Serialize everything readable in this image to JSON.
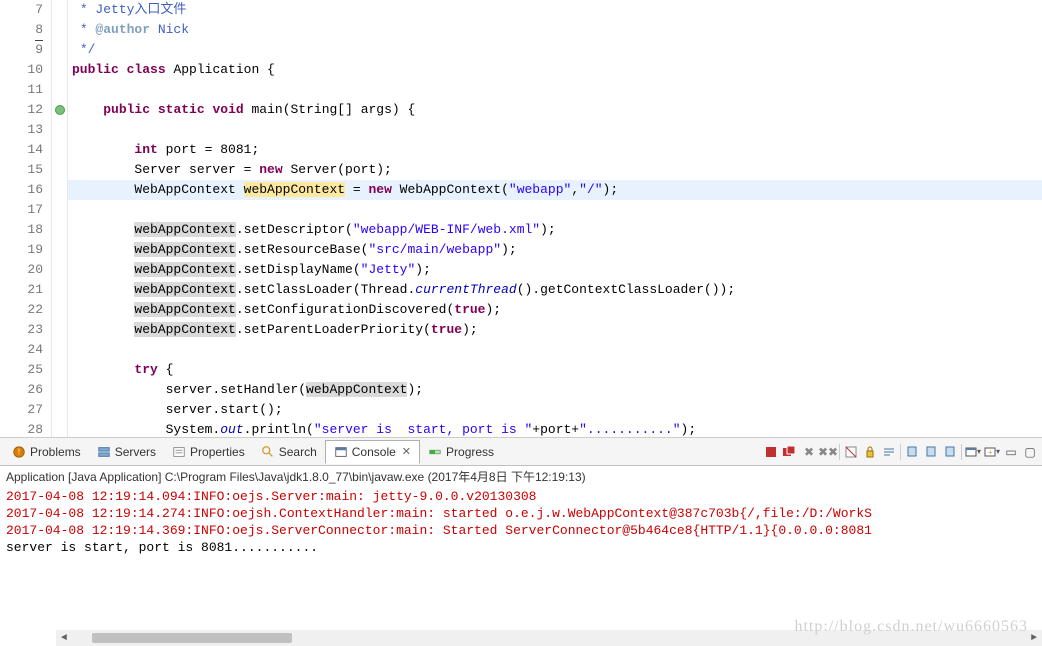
{
  "lines": [
    {
      "n": "7",
      "cls": "",
      "html": " <span class='com'>* Jetty入口文件</span>"
    },
    {
      "n": "8",
      "cls": "",
      "html": " <span class='com'>* <span class='com-tag'>@author</span> Nick</span>",
      "underline": true
    },
    {
      "n": "9",
      "cls": "",
      "html": " <span class='com'>*/</span>"
    },
    {
      "n": "10",
      "cls": "",
      "html": "<span class='kw'>public</span> <span class='kw'>class</span> Application {"
    },
    {
      "n": "11",
      "cls": "",
      "html": ""
    },
    {
      "n": "12",
      "cls": "",
      "html": "    <span class='kw'>public</span> <span class='kw'>static</span> <span class='kw'>void</span> main(String[] args) {",
      "marker": "green"
    },
    {
      "n": "13",
      "cls": "",
      "html": ""
    },
    {
      "n": "14",
      "cls": "",
      "html": "        <span class='kw'>int</span> port = 8081;"
    },
    {
      "n": "15",
      "cls": "",
      "html": "        Server server = <span class='kw'>new</span> Server(port);"
    },
    {
      "n": "16",
      "cls": "hl",
      "html": "        WebAppContext <span class='id-hl'>webAppContext</span> = <span class='kw'>new</span> WebAppContext(<span class='str'>\"webapp\"</span>,<span class='str'>\"/\"</span>);"
    },
    {
      "n": "17",
      "cls": "",
      "html": ""
    },
    {
      "n": "18",
      "cls": "",
      "html": "        <span class='id-ref'>webAppContext</span>.setDescriptor(<span class='str'>\"webapp/WEB-INF/web.xml\"</span>);"
    },
    {
      "n": "19",
      "cls": "",
      "html": "        <span class='id-ref'>webAppContext</span>.setResourceBase(<span class='str'>\"src/main/webapp\"</span>);"
    },
    {
      "n": "20",
      "cls": "",
      "html": "        <span class='id-ref'>webAppContext</span>.setDisplayName(<span class='str'>\"Jetty\"</span>);"
    },
    {
      "n": "21",
      "cls": "",
      "html": "        <span class='id-ref'>webAppContext</span>.setClassLoader(Thread.<span class='fld'>currentThread</span>().getContextClassLoader());"
    },
    {
      "n": "22",
      "cls": "",
      "html": "        <span class='id-ref'>webAppContext</span>.setConfigurationDiscovered(<span class='kw'>true</span>);"
    },
    {
      "n": "23",
      "cls": "",
      "html": "        <span class='id-ref'>webAppContext</span>.setParentLoaderPriority(<span class='kw'>true</span>);"
    },
    {
      "n": "24",
      "cls": "",
      "html": ""
    },
    {
      "n": "25",
      "cls": "",
      "html": "        <span class='kw'>try</span> {"
    },
    {
      "n": "26",
      "cls": "",
      "html": "            server.setHandler(<span class='id-ref'>webAppContext</span>);"
    },
    {
      "n": "27",
      "cls": "",
      "html": "            server.start();"
    },
    {
      "n": "28",
      "cls": "",
      "html": "            System.<span class='fld'>out</span>.println(<span class='str'>\"server is  start, port is \"</span>+port+<span class='str'>\"...........\"</span>);"
    }
  ],
  "tabs": {
    "problems": "Problems",
    "servers": "Servers",
    "properties": "Properties",
    "search": "Search",
    "console": "Console",
    "progress": "Progress"
  },
  "console": {
    "header": "Application [Java Application] C:\\Program Files\\Java\\jdk1.8.0_77\\bin\\javaw.exe (2017年4月8日 下午12:19:13)",
    "lines": [
      {
        "cls": "red",
        "text": "2017-04-08 12:19:14.094:INFO:oejs.Server:main: jetty-9.0.0.v20130308"
      },
      {
        "cls": "red",
        "text": "2017-04-08 12:19:14.274:INFO:oejsh.ContextHandler:main: started o.e.j.w.WebAppContext@387c703b{/,file:/D:/WorkS"
      },
      {
        "cls": "red",
        "text": "2017-04-08 12:19:14.369:INFO:oejs.ServerConnector:main: Started ServerConnector@5b464ce8{HTTP/1.1}{0.0.0.0:8081"
      },
      {
        "cls": "",
        "text": "server is  start, port is 8081..........."
      }
    ]
  },
  "watermark": "http://blog.csdn.net/wu6660563"
}
